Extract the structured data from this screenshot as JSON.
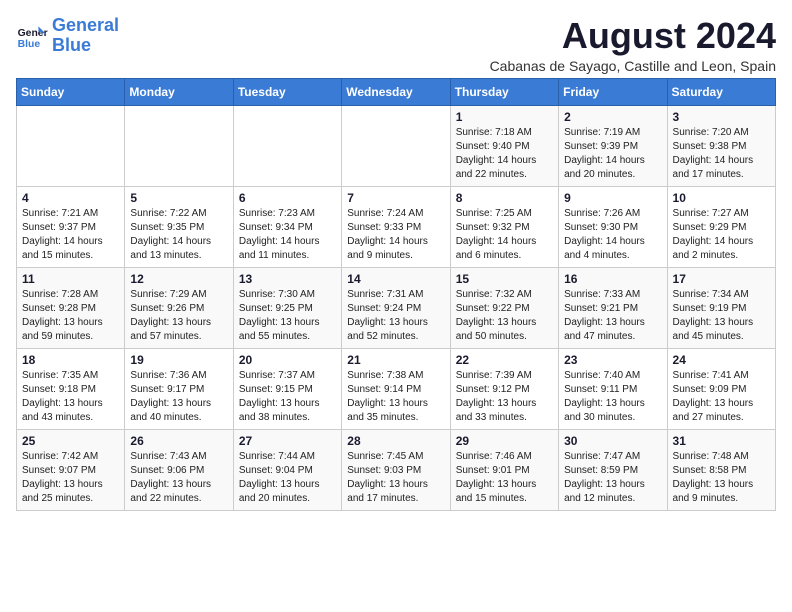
{
  "logo": {
    "line1": "General",
    "line2": "Blue"
  },
  "title": "August 2024",
  "location": "Cabanas de Sayago, Castille and Leon, Spain",
  "days_of_week": [
    "Sunday",
    "Monday",
    "Tuesday",
    "Wednesday",
    "Thursday",
    "Friday",
    "Saturday"
  ],
  "weeks": [
    [
      {
        "day": "",
        "info": ""
      },
      {
        "day": "",
        "info": ""
      },
      {
        "day": "",
        "info": ""
      },
      {
        "day": "",
        "info": ""
      },
      {
        "day": "1",
        "info": "Sunrise: 7:18 AM\nSunset: 9:40 PM\nDaylight: 14 hours\nand 22 minutes."
      },
      {
        "day": "2",
        "info": "Sunrise: 7:19 AM\nSunset: 9:39 PM\nDaylight: 14 hours\nand 20 minutes."
      },
      {
        "day": "3",
        "info": "Sunrise: 7:20 AM\nSunset: 9:38 PM\nDaylight: 14 hours\nand 17 minutes."
      }
    ],
    [
      {
        "day": "4",
        "info": "Sunrise: 7:21 AM\nSunset: 9:37 PM\nDaylight: 14 hours\nand 15 minutes."
      },
      {
        "day": "5",
        "info": "Sunrise: 7:22 AM\nSunset: 9:35 PM\nDaylight: 14 hours\nand 13 minutes."
      },
      {
        "day": "6",
        "info": "Sunrise: 7:23 AM\nSunset: 9:34 PM\nDaylight: 14 hours\nand 11 minutes."
      },
      {
        "day": "7",
        "info": "Sunrise: 7:24 AM\nSunset: 9:33 PM\nDaylight: 14 hours\nand 9 minutes."
      },
      {
        "day": "8",
        "info": "Sunrise: 7:25 AM\nSunset: 9:32 PM\nDaylight: 14 hours\nand 6 minutes."
      },
      {
        "day": "9",
        "info": "Sunrise: 7:26 AM\nSunset: 9:30 PM\nDaylight: 14 hours\nand 4 minutes."
      },
      {
        "day": "10",
        "info": "Sunrise: 7:27 AM\nSunset: 9:29 PM\nDaylight: 14 hours\nand 2 minutes."
      }
    ],
    [
      {
        "day": "11",
        "info": "Sunrise: 7:28 AM\nSunset: 9:28 PM\nDaylight: 13 hours\nand 59 minutes."
      },
      {
        "day": "12",
        "info": "Sunrise: 7:29 AM\nSunset: 9:26 PM\nDaylight: 13 hours\nand 57 minutes."
      },
      {
        "day": "13",
        "info": "Sunrise: 7:30 AM\nSunset: 9:25 PM\nDaylight: 13 hours\nand 55 minutes."
      },
      {
        "day": "14",
        "info": "Sunrise: 7:31 AM\nSunset: 9:24 PM\nDaylight: 13 hours\nand 52 minutes."
      },
      {
        "day": "15",
        "info": "Sunrise: 7:32 AM\nSunset: 9:22 PM\nDaylight: 13 hours\nand 50 minutes."
      },
      {
        "day": "16",
        "info": "Sunrise: 7:33 AM\nSunset: 9:21 PM\nDaylight: 13 hours\nand 47 minutes."
      },
      {
        "day": "17",
        "info": "Sunrise: 7:34 AM\nSunset: 9:19 PM\nDaylight: 13 hours\nand 45 minutes."
      }
    ],
    [
      {
        "day": "18",
        "info": "Sunrise: 7:35 AM\nSunset: 9:18 PM\nDaylight: 13 hours\nand 43 minutes."
      },
      {
        "day": "19",
        "info": "Sunrise: 7:36 AM\nSunset: 9:17 PM\nDaylight: 13 hours\nand 40 minutes."
      },
      {
        "day": "20",
        "info": "Sunrise: 7:37 AM\nSunset: 9:15 PM\nDaylight: 13 hours\nand 38 minutes."
      },
      {
        "day": "21",
        "info": "Sunrise: 7:38 AM\nSunset: 9:14 PM\nDaylight: 13 hours\nand 35 minutes."
      },
      {
        "day": "22",
        "info": "Sunrise: 7:39 AM\nSunset: 9:12 PM\nDaylight: 13 hours\nand 33 minutes."
      },
      {
        "day": "23",
        "info": "Sunrise: 7:40 AM\nSunset: 9:11 PM\nDaylight: 13 hours\nand 30 minutes."
      },
      {
        "day": "24",
        "info": "Sunrise: 7:41 AM\nSunset: 9:09 PM\nDaylight: 13 hours\nand 27 minutes."
      }
    ],
    [
      {
        "day": "25",
        "info": "Sunrise: 7:42 AM\nSunset: 9:07 PM\nDaylight: 13 hours\nand 25 minutes."
      },
      {
        "day": "26",
        "info": "Sunrise: 7:43 AM\nSunset: 9:06 PM\nDaylight: 13 hours\nand 22 minutes."
      },
      {
        "day": "27",
        "info": "Sunrise: 7:44 AM\nSunset: 9:04 PM\nDaylight: 13 hours\nand 20 minutes."
      },
      {
        "day": "28",
        "info": "Sunrise: 7:45 AM\nSunset: 9:03 PM\nDaylight: 13 hours\nand 17 minutes."
      },
      {
        "day": "29",
        "info": "Sunrise: 7:46 AM\nSunset: 9:01 PM\nDaylight: 13 hours\nand 15 minutes."
      },
      {
        "day": "30",
        "info": "Sunrise: 7:47 AM\nSunset: 8:59 PM\nDaylight: 13 hours\nand 12 minutes."
      },
      {
        "day": "31",
        "info": "Sunrise: 7:48 AM\nSunset: 8:58 PM\nDaylight: 13 hours\nand 9 minutes."
      }
    ]
  ]
}
